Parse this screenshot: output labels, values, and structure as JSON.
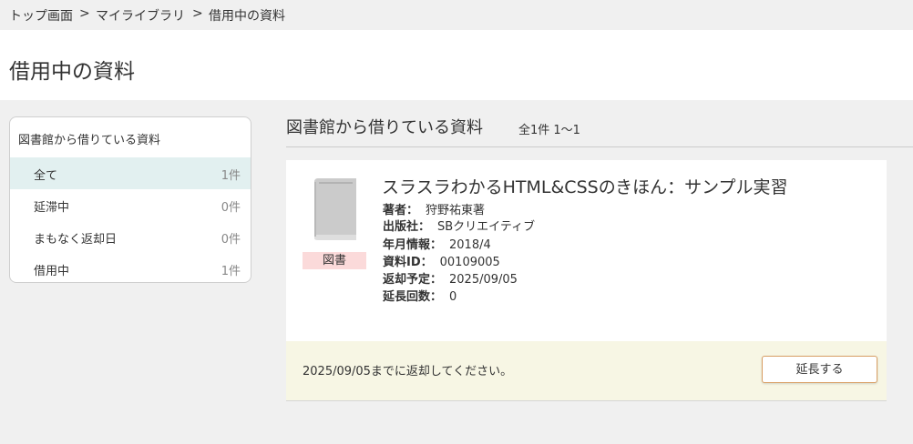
{
  "breadcrumb": {
    "items": [
      "トップ画面",
      "マイライブラリ",
      "借用中の資料"
    ],
    "separator": ">"
  },
  "page_title": "借用中の資料",
  "sidebar": {
    "heading": "図書館から借りている資料",
    "items": [
      {
        "label": "全て",
        "count": "1件",
        "active": true
      },
      {
        "label": "延滞中",
        "count": "0件",
        "active": false
      },
      {
        "label": "まもなく返却日",
        "count": "0件",
        "active": false
      },
      {
        "label": "借用中",
        "count": "1件",
        "active": false
      }
    ]
  },
  "main": {
    "heading": "図書館から借りている資料",
    "count_text": "全1件 1〜1"
  },
  "item": {
    "type_badge": "図書",
    "icon": "book-icon",
    "title": "スラスラわかるHTML&CSSのきほん：サンプル実習",
    "meta": [
      {
        "key": "著者：",
        "value": "狩野祐東著"
      },
      {
        "key": "出版社：",
        "value": "SBクリエイティブ"
      },
      {
        "key": "年月情報：",
        "value": "2018/4"
      },
      {
        "key": "資料ID：",
        "value": "00109005"
      },
      {
        "key": "返却予定：",
        "value": "2025/09/05"
      },
      {
        "key": "延長回数：",
        "value": "0"
      }
    ],
    "due_message": "2025/09/05までに返却してください。",
    "extend_label": "延長する"
  },
  "colors": {
    "active_item_bg": "#e2f0f0",
    "badge_bg": "#fbdada",
    "footer_bg": "#f7f6e4",
    "button_border": "#d9a066"
  }
}
